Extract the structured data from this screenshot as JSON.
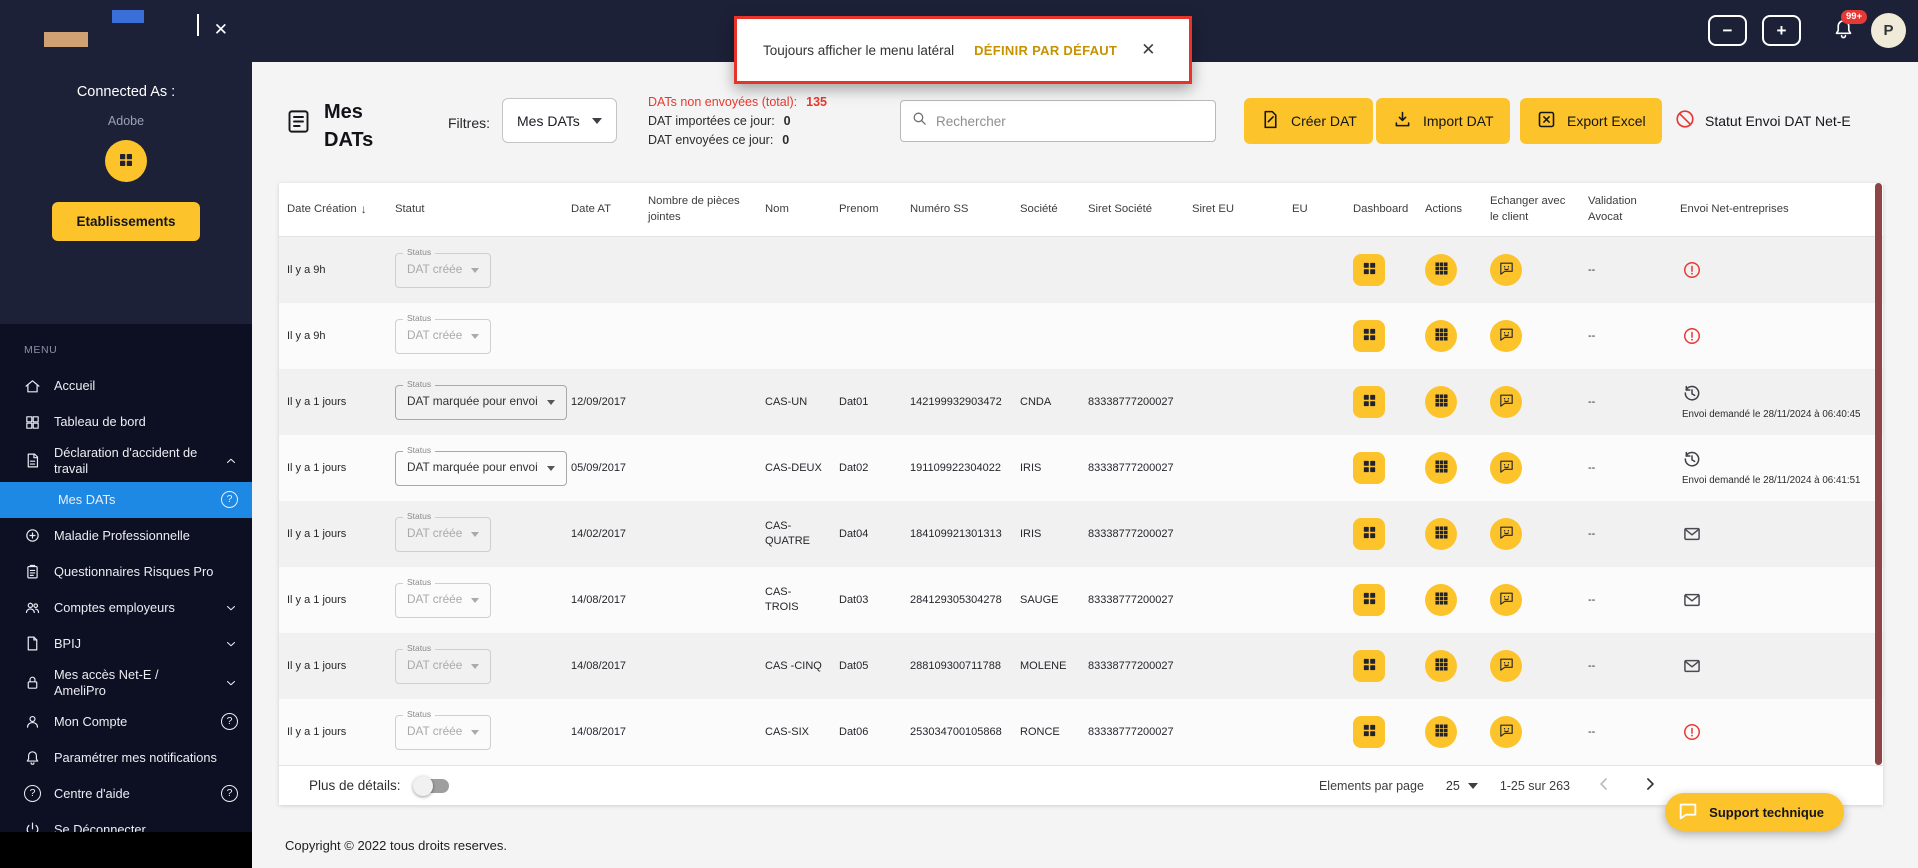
{
  "accent_color": "#fcc32b",
  "alert_color": "#e53935",
  "selected_color": "#1e88e5",
  "icons": {
    "help_glyph": "?",
    "close_glyph": "✕",
    "sort_desc_glyph": "↓",
    "zoom_out_glyph": "−",
    "zoom_in_glyph": "+"
  },
  "sidebar": {
    "connected_as": "Connected As :",
    "account_name": "Adobe",
    "establishments_button": "Etablissements",
    "menu_label": "MENU",
    "items": [
      {
        "label": "Accueil"
      },
      {
        "label": "Tableau de bord"
      },
      {
        "label": "Déclaration d'accident de travail"
      },
      {
        "label": "Mes DATs"
      },
      {
        "label": "Maladie Professionnelle"
      },
      {
        "label": "Questionnaires Risques Pro"
      },
      {
        "label": "Comptes employeurs"
      },
      {
        "label": "BPIJ"
      },
      {
        "label": "Mes accès Net-E / AmeliPro"
      },
      {
        "label": "Mon Compte"
      },
      {
        "label": "Paramétrer mes notifications"
      },
      {
        "label": "Centre d'aide"
      },
      {
        "label": "Se Déconnecter"
      }
    ]
  },
  "topbar": {
    "toast": {
      "message": "Toujours afficher le menu latéral",
      "action_label": "DÉFINIR PAR DÉFAUT"
    },
    "notification_badge": "99+",
    "avatar_initial": "P"
  },
  "header": {
    "title": "Mes DATs",
    "filters_label": "Filtres:",
    "filter_dropdown_value": "Mes DATs",
    "stats": [
      {
        "label": "DATs non envoyées (total):",
        "value": "135"
      },
      {
        "label": "DAT importées ce jour:",
        "value": "0"
      },
      {
        "label": "DAT envoyées ce jour:",
        "value": "0"
      }
    ],
    "search_placeholder": "Rechercher",
    "create_button": "Créer DAT",
    "import_button": "Import DAT",
    "export_button": "Export Excel",
    "status_link": "Statut Envoi DAT Net-E"
  },
  "table": {
    "columns": [
      "Date Création",
      "Statut",
      "Date AT",
      "Nombre de pièces jointes",
      "Nom",
      "Prenom",
      "Numéro SS",
      "Société",
      "Siret Société",
      "Siret EU",
      "EU",
      "Dashboard",
      "Actions",
      "Echanger avec le client",
      "Validation Avocat",
      "Envoi Net-entreprises"
    ],
    "status_field_label": "Status",
    "rows": [
      {
        "date_creation": "Il y a 9h",
        "statut": "DAT créée",
        "statut_disabled": true,
        "date_at": "",
        "nom": "",
        "prenom": "",
        "numero_ss": "",
        "societe": "",
        "siret_societe": "",
        "validation_avocat": "--",
        "envoi_type": "error"
      },
      {
        "date_creation": "Il y a 9h",
        "statut": "DAT créée",
        "statut_disabled": true,
        "date_at": "",
        "nom": "",
        "prenom": "",
        "numero_ss": "",
        "societe": "",
        "siret_societe": "",
        "validation_avocat": "--",
        "envoi_type": "error"
      },
      {
        "date_creation": "Il y a 1 jours",
        "statut": "DAT marquée pour envoi",
        "statut_disabled": false,
        "date_at": "12/09/2017",
        "nom": "CAS-UN",
        "prenom": "Dat01",
        "numero_ss": "142199932903472",
        "societe": "CNDA",
        "siret_societe": "83338777200027",
        "validation_avocat": "--",
        "envoi_type": "pending",
        "envoi_text": "Envoi demandé le 28/11/2024 à 06:40:45"
      },
      {
        "date_creation": "Il y a 1 jours",
        "statut": "DAT marquée pour envoi",
        "statut_disabled": false,
        "date_at": "05/09/2017",
        "nom": "CAS-DEUX",
        "prenom": "Dat02",
        "numero_ss": "191109922304022",
        "societe": "IRIS",
        "siret_societe": "83338777200027",
        "validation_avocat": "--",
        "envoi_type": "pending",
        "envoi_text": "Envoi demandé le 28/11/2024 à 06:41:51"
      },
      {
        "date_creation": "Il y a 1 jours",
        "statut": "DAT créée",
        "statut_disabled": true,
        "date_at": "14/02/2017",
        "nom": "CAS-QUATRE",
        "prenom": "Dat04",
        "numero_ss": "184109921301313",
        "societe": "IRIS",
        "siret_societe": "83338777200027",
        "validation_avocat": "--",
        "envoi_type": "mail"
      },
      {
        "date_creation": "Il y a 1 jours",
        "statut": "DAT créée",
        "statut_disabled": true,
        "date_at": "14/08/2017",
        "nom": "CAS-TROIS",
        "prenom": "Dat03",
        "numero_ss": "284129305304278",
        "societe": "SAUGE",
        "siret_societe": "83338777200027",
        "validation_avocat": "--",
        "envoi_type": "mail"
      },
      {
        "date_creation": "Il y a 1 jours",
        "statut": "DAT créée",
        "statut_disabled": true,
        "date_at": "14/08/2017",
        "nom": "CAS -CINQ",
        "prenom": "Dat05",
        "numero_ss": "288109300711788",
        "societe": "MOLENE",
        "siret_societe": "83338777200027",
        "validation_avocat": "--",
        "envoi_type": "mail"
      },
      {
        "date_creation": "Il y a 1 jours",
        "statut": "DAT créée",
        "statut_disabled": true,
        "date_at": "14/08/2017",
        "nom": "CAS-SIX",
        "prenom": "Dat06",
        "numero_ss": "253034700105868",
        "societe": "RONCE",
        "siret_societe": "83338777200027",
        "validation_avocat": "--",
        "envoi_type": "error"
      }
    ]
  },
  "pagination": {
    "details_toggle_label": "Plus de détails:",
    "per_page_label": "Elements par page",
    "per_page_value": "25",
    "range_text": "1-25 sur 263"
  },
  "copyright": "Copyright © 2022 tous droits reserves.",
  "support_button": "Support technique"
}
